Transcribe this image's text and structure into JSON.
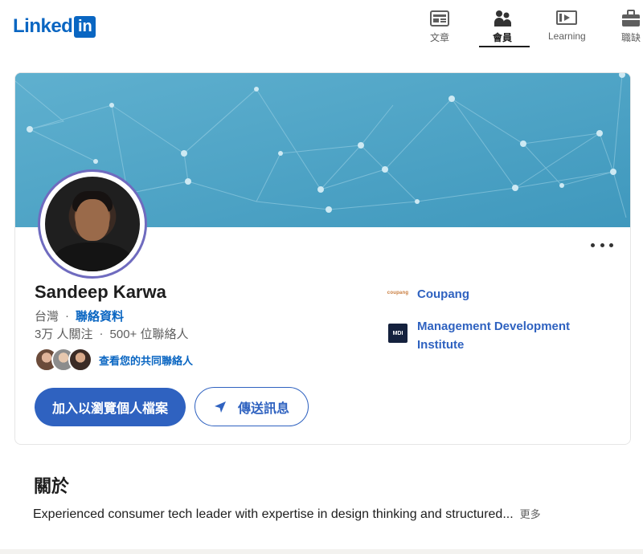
{
  "header": {
    "logo_text": "Linked",
    "logo_badge": "in",
    "brand_color": "#0a66c2",
    "nav": [
      {
        "label": "文章",
        "icon": "articles-icon"
      },
      {
        "label": "會員",
        "icon": "people-icon",
        "active": true
      },
      {
        "label": "Learning",
        "icon": "learning-icon"
      },
      {
        "label": "職缺",
        "icon": "jobs-icon"
      }
    ]
  },
  "profile": {
    "name": "Sandeep Karwa",
    "location": "台灣",
    "separator": "·",
    "contact_info_label": "聯絡資料",
    "followers": "3万 人關注",
    "connections": "500+ 位聯絡人",
    "mutual_connections_label": "查看您的共同聯絡人",
    "join_button": "加入以瀏覽個人檔案",
    "message_button": "傳送訊息",
    "more_menu_icon": "more-horizontal-icon",
    "companies": [
      {
        "name": "Coupang",
        "logo_text": "coupang"
      },
      {
        "name": "Management Development Institute",
        "logo_text": "MDI"
      }
    ],
    "colors": {
      "primary_button": "#2f62c0",
      "link": "#0a66c2",
      "avatar_ring": "#6f6bbf",
      "banner": "#4da5c6"
    }
  },
  "about": {
    "title": "關於",
    "text": "Experienced consumer tech leader with expertise in design thinking and structured...",
    "more_label": "更多"
  }
}
